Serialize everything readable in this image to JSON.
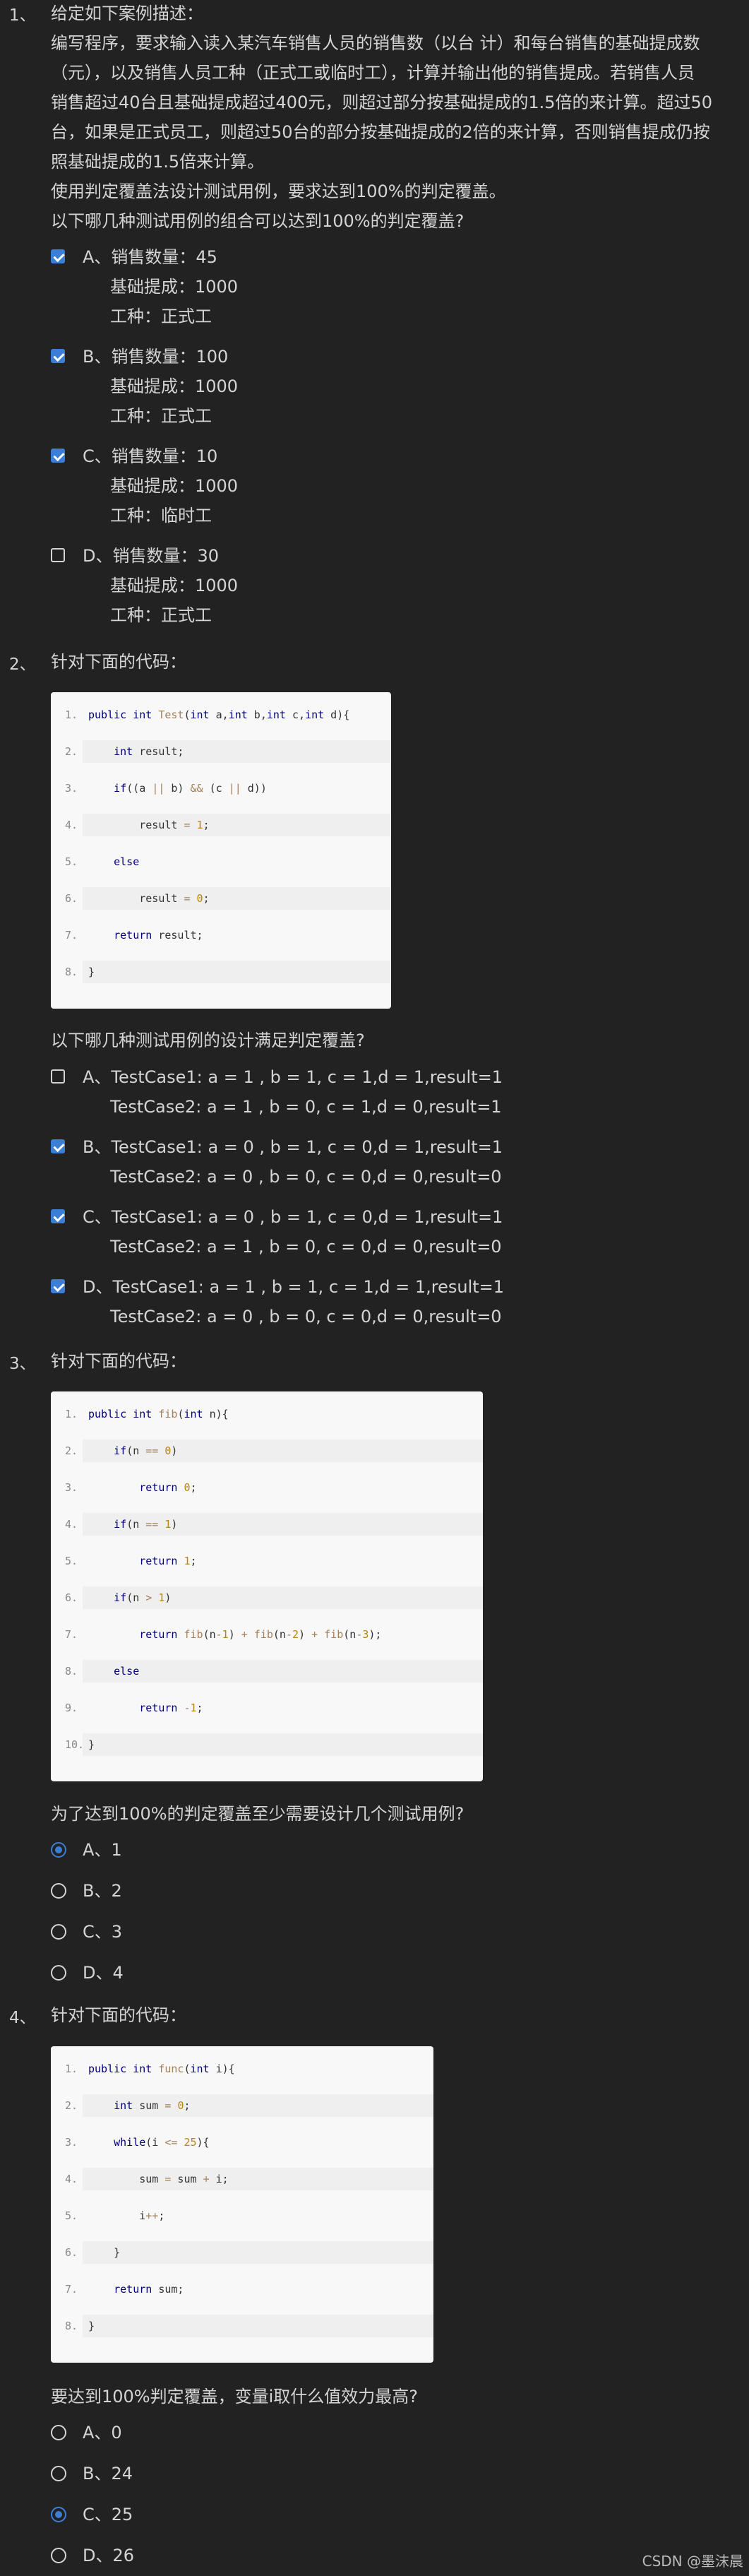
{
  "questions": [
    {
      "num": "1、",
      "stem": [
        "给定如下案例描述：",
        "编写程序，要求输入读入某汽车销售人员的销售数（以台 计）和每台销售的基础提成数",
        "（元），以及销售人员工种（正式工或临时工），计算并输出他的销售提成。若销售人员",
        "销售超过40台且基础提成超过400元，则超过部分按基础提成的1.5倍的来计算。超过50",
        "台，如果是正式员工，则超过50台的部分按基础提成的2倍的来计算，否则销售提成仍按",
        "照基础提成的1.5倍来计算。",
        "使用判定覆盖法设计测试用例，要求达到100%的判定覆盖。",
        "以下哪几种测试用例的组合可以达到100%的判定覆盖?"
      ],
      "options": [
        {
          "lines": [
            "A、销售数量：45",
            "基础提成：1000",
            "工种：正式工"
          ],
          "checked": true
        },
        {
          "lines": [
            "B、销售数量：100",
            "基础提成：1000",
            "工种：正式工"
          ],
          "checked": true
        },
        {
          "lines": [
            "C、销售数量：10",
            "基础提成：1000",
            "工种：临时工"
          ],
          "checked": true
        },
        {
          "lines": [
            "D、销售数量：30",
            "基础提成：1000",
            "工种：正式工"
          ],
          "checked": false
        }
      ]
    },
    {
      "num": "2、",
      "intro": "针对下面的代码：",
      "code": [
        "public int Test(int a,int b,int c,int d){",
        "    int result;",
        "    if((a || b) && (c || d))",
        "        result = 1;",
        "    else",
        "        result = 0;",
        "    return result;",
        "}"
      ],
      "question": "以下哪几种测试用例的设计满足判定覆盖?",
      "options": [
        {
          "lines": [
            "A、TestCase1: a = 1 , b = 1, c = 1,d = 1,result=1",
            "TestCase2: a = 1 , b = 0, c = 1,d = 0,result=1"
          ],
          "checked": false
        },
        {
          "lines": [
            "B、TestCase1: a = 0 , b = 1, c = 0,d = 1,result=1",
            "TestCase2: a = 0 , b = 0, c = 0,d = 0,result=0"
          ],
          "checked": true
        },
        {
          "lines": [
            "C、TestCase1: a = 0 , b = 1, c = 0,d = 1,result=1",
            "TestCase2: a = 1 , b = 0, c = 0,d = 0,result=0"
          ],
          "checked": true
        },
        {
          "lines": [
            "D、TestCase1: a = 1 , b = 1, c = 1,d = 1,result=1",
            "TestCase2: a = 0 , b = 0, c = 0,d = 0,result=0"
          ],
          "checked": true
        }
      ]
    },
    {
      "num": "3、",
      "intro": "针对下面的代码：",
      "code": [
        "public int fib(int n){",
        "    if(n == 0)",
        "        return 0;",
        "    if(n == 1)",
        "        return 1;",
        "    if(n > 1)",
        "        return fib(n-1) + fib(n-2) + fib(n-3);",
        "    else",
        "        return -1;",
        "}"
      ],
      "question": "为了达到100%的判定覆盖至少需要设计几个测试用例?",
      "options": [
        {
          "lines": [
            "A、1"
          ],
          "checked": true
        },
        {
          "lines": [
            "B、2"
          ],
          "checked": false
        },
        {
          "lines": [
            "C、3"
          ],
          "checked": false
        },
        {
          "lines": [
            "D、4"
          ],
          "checked": false
        }
      ]
    },
    {
      "num": "4、",
      "intro": "针对下面的代码：",
      "code": [
        "public int func(int i){",
        "    int sum = 0;",
        "    while(i <= 25){",
        "        sum = sum + i;",
        "        i++;",
        "    }",
        "    return sum;",
        "}"
      ],
      "question": "要达到100%判定覆盖，变量i取什么值效力最高?",
      "options": [
        {
          "lines": [
            "A、0"
          ],
          "checked": false
        },
        {
          "lines": [
            "B、24"
          ],
          "checked": false
        },
        {
          "lines": [
            "C、25"
          ],
          "checked": true
        },
        {
          "lines": [
            "D、26"
          ],
          "checked": false
        }
      ]
    }
  ],
  "footer": "CSDN @墨沫晨"
}
